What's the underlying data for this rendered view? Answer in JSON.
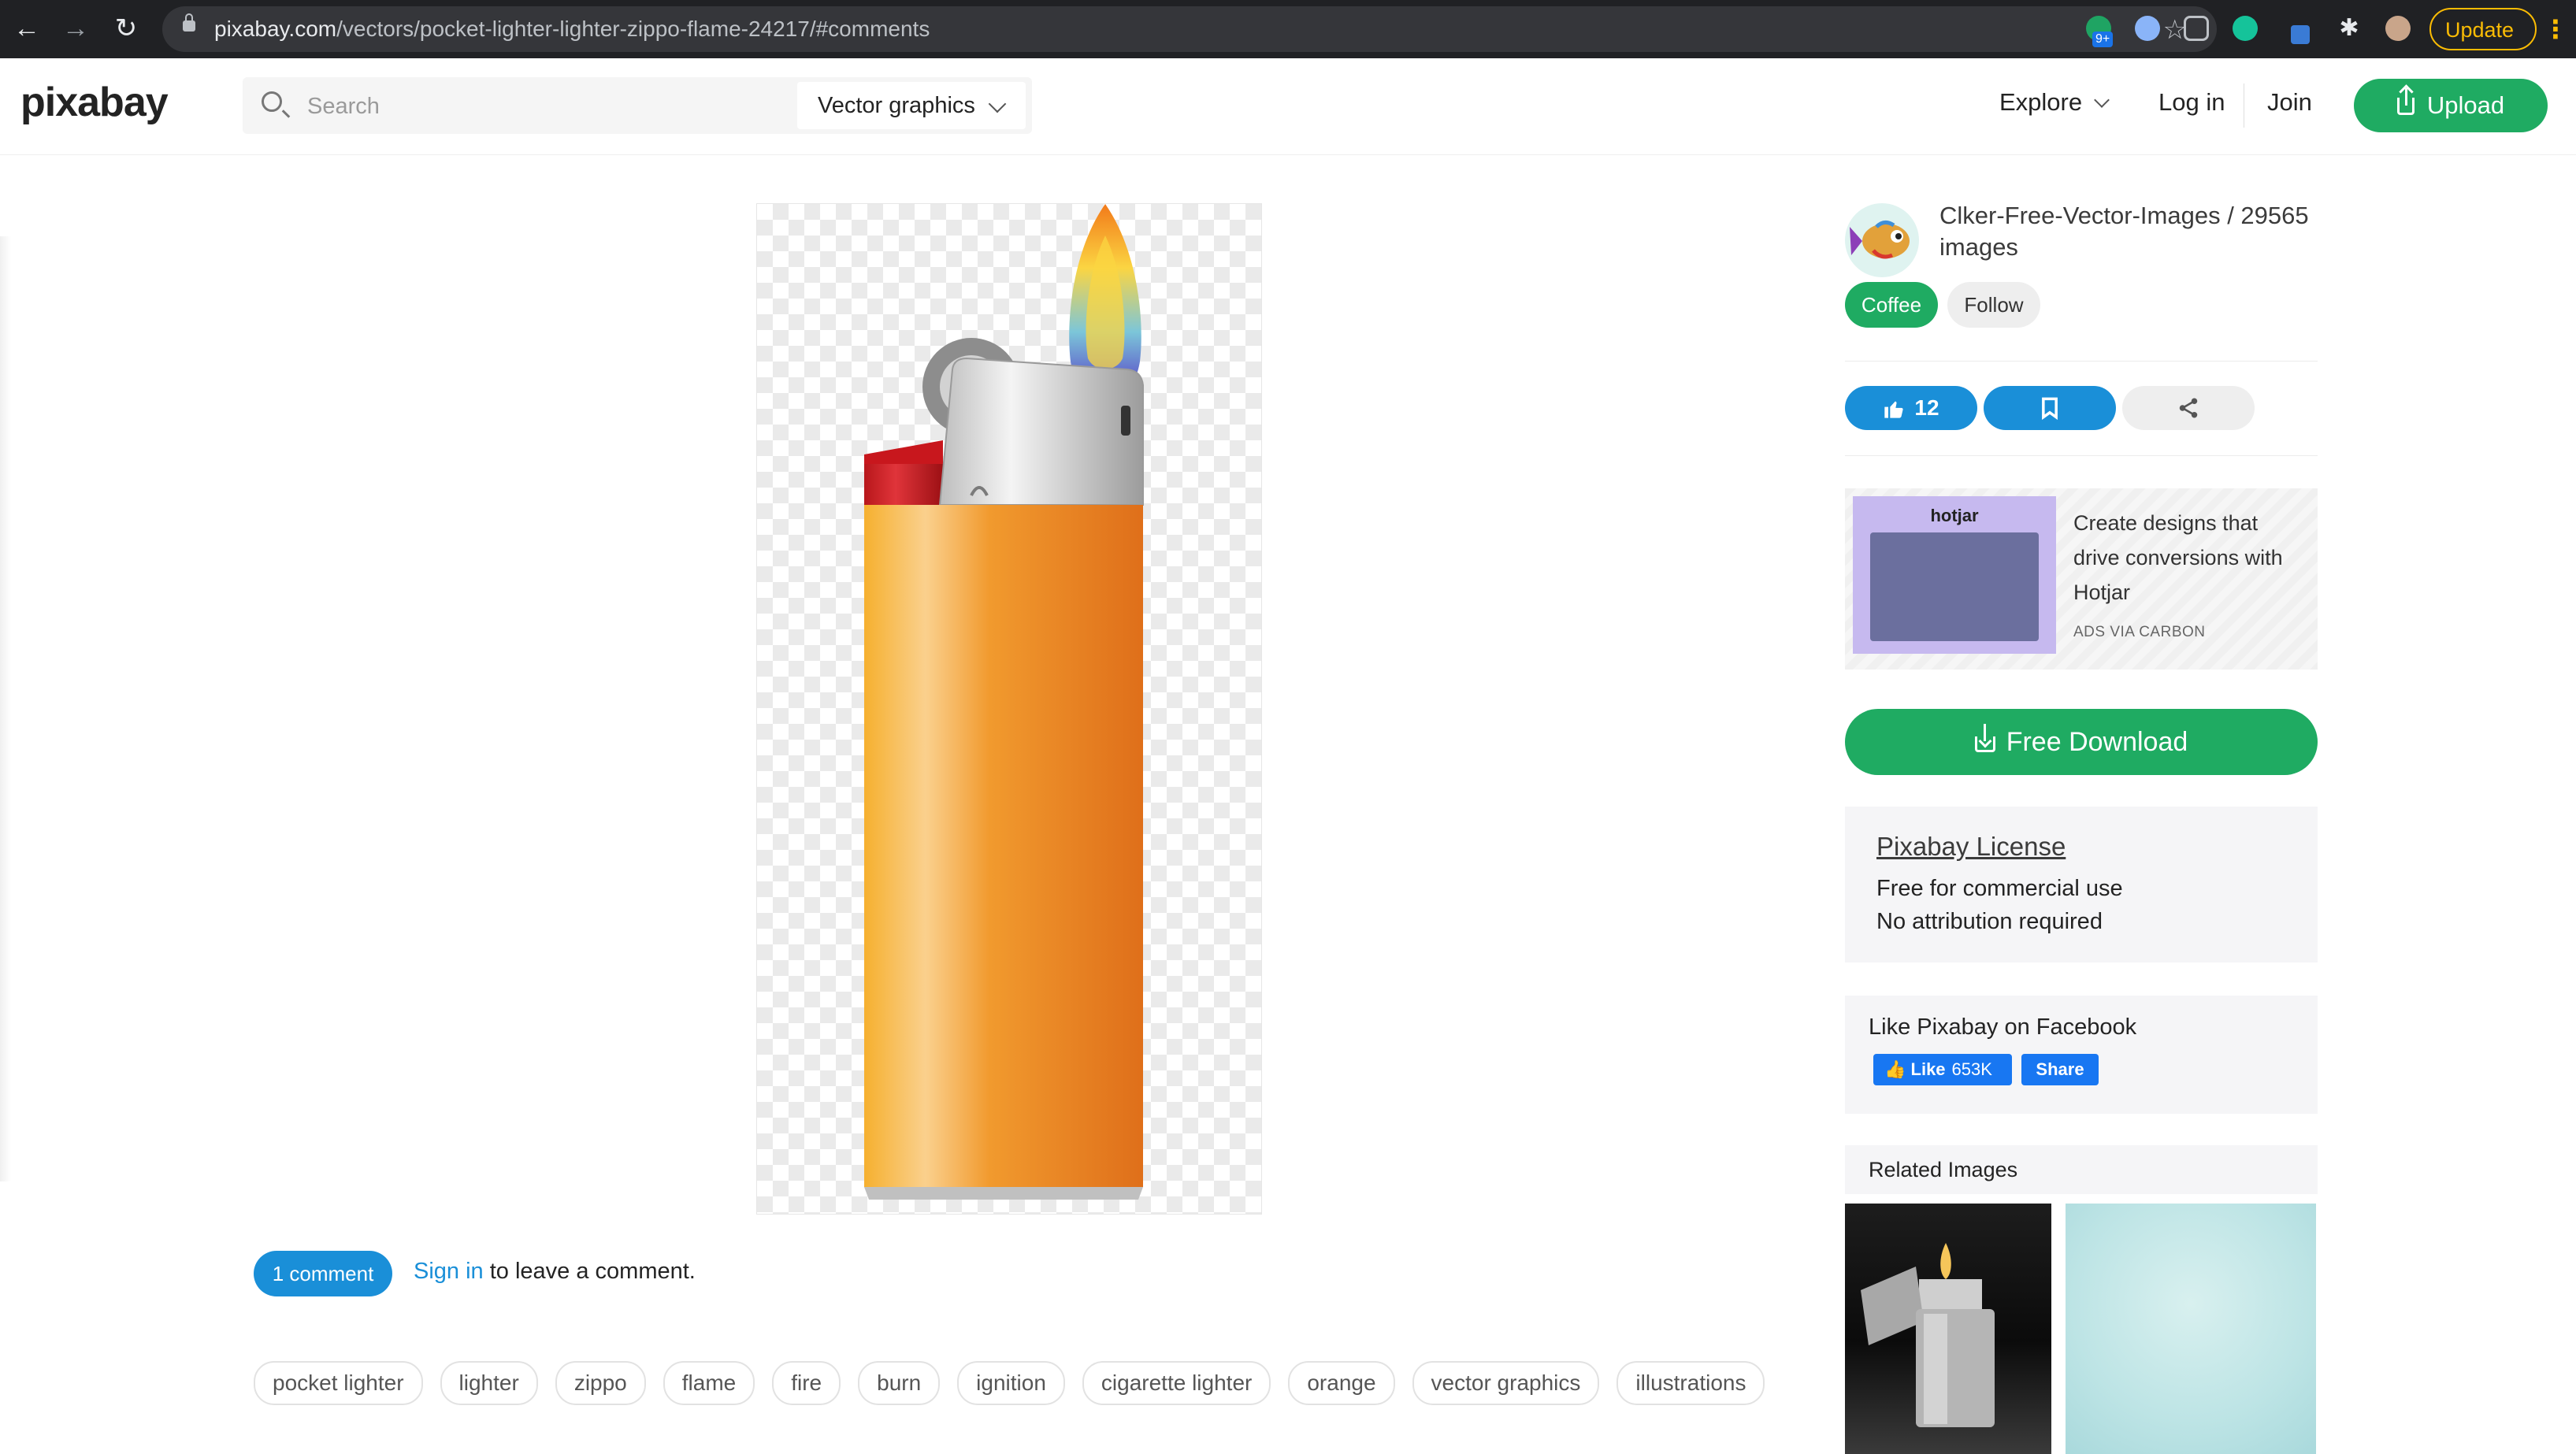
{
  "browser": {
    "url_host": "pixabay.com",
    "url_path": "/vectors/pocket-lighter-lighter-zippo-flame-24217/#comments",
    "update_label": "Update",
    "ext_badge": "9+"
  },
  "header": {
    "logo": "pixabay",
    "search_placeholder": "Search",
    "search_type": "Vector graphics",
    "explore": "Explore",
    "login": "Log in",
    "join": "Join",
    "upload": "Upload"
  },
  "comments": {
    "badge": "1 comment",
    "sign_in": "Sign in",
    "rest": " to leave a comment."
  },
  "tags": [
    "pocket lighter",
    "lighter",
    "zippo",
    "flame",
    "fire",
    "burn",
    "ignition",
    "cigarette lighter",
    "orange",
    "vector graphics",
    "illustrations"
  ],
  "author": {
    "name": "Clker-Free-Vector-Images / 29565 images",
    "coffee": "Coffee",
    "follow": "Follow"
  },
  "actions": {
    "likes": "12"
  },
  "ad": {
    "brand": "hotjar",
    "copy": "Create designs that drive conversions with Hotjar",
    "via": "ADS VIA CARBON"
  },
  "download": {
    "label": "Free Download"
  },
  "license": {
    "title": "Pixabay License",
    "line1": "Free for commercial use",
    "line2": "No attribution required"
  },
  "facebook": {
    "title": "Like Pixabay on Facebook",
    "like": "Like",
    "count": "653K",
    "share": "Share"
  },
  "related": {
    "title": "Related Images"
  },
  "colors": {
    "brand_green": "#1fab62",
    "accent_blue": "#1a8fd8",
    "lighter_orange": "#f29a2e"
  }
}
